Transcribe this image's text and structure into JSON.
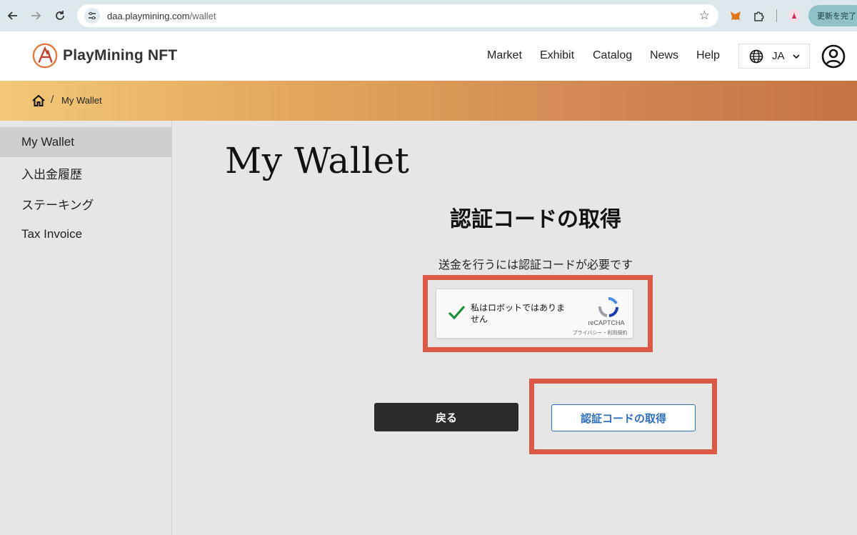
{
  "browser": {
    "url_host": "daa.playmining.com",
    "url_path": "/wallet",
    "update_label": "更新を完了"
  },
  "header": {
    "logo_text": "PlayMining NFT",
    "nav": [
      "Market",
      "Exhibit",
      "Catalog",
      "News",
      "Help"
    ],
    "language": "JA"
  },
  "breadcrumb": {
    "separator": "/",
    "current": "My Wallet"
  },
  "sidebar": {
    "items": [
      {
        "label": "My Wallet",
        "active": true
      },
      {
        "label": "入出金履歴",
        "active": false
      },
      {
        "label": "ステーキング",
        "active": false
      },
      {
        "label": "Tax Invoice",
        "active": false
      }
    ]
  },
  "main": {
    "page_title": "My Wallet",
    "section_title": "認証コードの取得",
    "note": "送金を行うには認証コードが必要です",
    "captcha": {
      "label": "私はロボットではありません",
      "brand": "reCAPTCHA",
      "links": "プライバシー・利用規約",
      "checked": true
    },
    "back_button": "戻る",
    "get_code_button": "認証コードの取得"
  },
  "colors": {
    "highlight": "#dc5a45",
    "primary_link": "#2f6fbf",
    "dark_button": "#2b2b2b"
  }
}
